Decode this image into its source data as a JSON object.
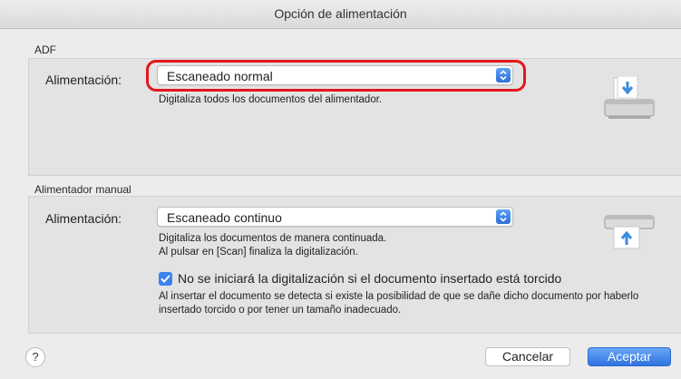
{
  "window": {
    "title": "Opción de alimentación"
  },
  "adf": {
    "group_label": "ADF",
    "feed_label": "Alimentación:",
    "feed_value": "Escaneado normal",
    "description": "Digitaliza todos los documentos del alimentador.",
    "icon": "scanner-adf-icon"
  },
  "manual": {
    "group_label": "Alimentador manual",
    "feed_label": "Alimentación:",
    "feed_value": "Escaneado continuo",
    "description_line1": "Digitaliza los documentos de manera continuada.",
    "description_line2": "Al pulsar en [Scan] finaliza la digitalización.",
    "checkbox_checked": true,
    "checkbox_label": "No se iniciará la digitalización si el documento insertado está torcido",
    "note_line1": "Al insertar el documento se detecta si existe la posibilidad de que se dañe dicho documento por haberlo",
    "note_line2": "insertado torcido o por tener un tamaño inadecuado.",
    "icon": "scanner-manual-icon"
  },
  "footer": {
    "help_label": "?",
    "cancel_label": "Cancelar",
    "ok_label": "Aceptar"
  },
  "colors": {
    "accent": "#3b82f0",
    "highlight": "#e4161c"
  }
}
